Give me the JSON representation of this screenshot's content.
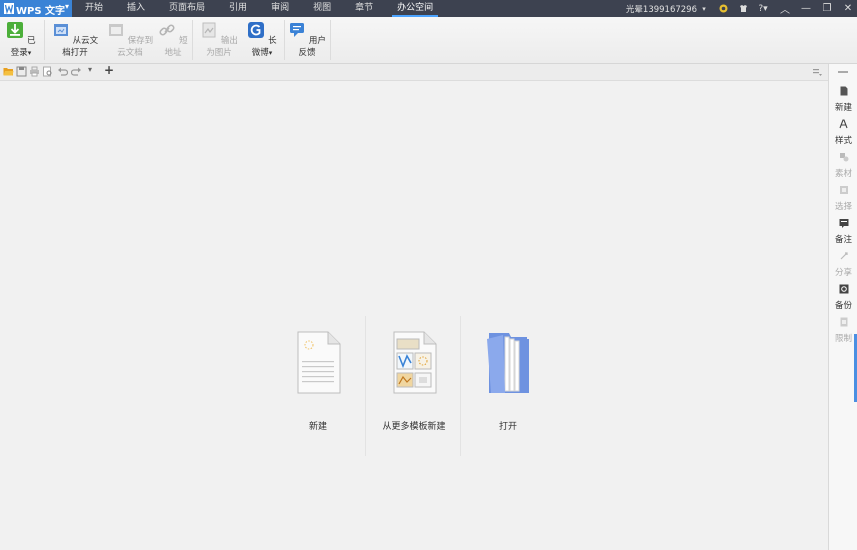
{
  "app": {
    "title": "WPS 文字"
  },
  "menu": [
    {
      "label": "开始",
      "active": false
    },
    {
      "label": "插入",
      "active": false
    },
    {
      "label": "页面布局",
      "active": false
    },
    {
      "label": "引用",
      "active": false
    },
    {
      "label": "审阅",
      "active": false
    },
    {
      "label": "视图",
      "active": false
    },
    {
      "label": "章节",
      "active": false
    },
    {
      "label": "办公空间",
      "active": true
    }
  ],
  "titlebar": {
    "user": "光晕1399167296"
  },
  "ribbon": {
    "logged_in": "已登录",
    "open_cloud": "从云文档打开",
    "save_cloud": "保存到云文档",
    "short_url": "短地址",
    "export_image": "输出为图片",
    "long_weibo": "长微博",
    "feedback": "用户反馈"
  },
  "side": {
    "new": "新建",
    "style": "样式",
    "material": "素材",
    "select": "选择",
    "note": "备注",
    "share": "分享",
    "backup": "备份",
    "restrict": "限制"
  },
  "start": {
    "new": "新建",
    "template": "从更多模板新建",
    "open": "打开"
  },
  "colors": {
    "accent": "#3a83d6",
    "titlebar": "#3d4250"
  }
}
